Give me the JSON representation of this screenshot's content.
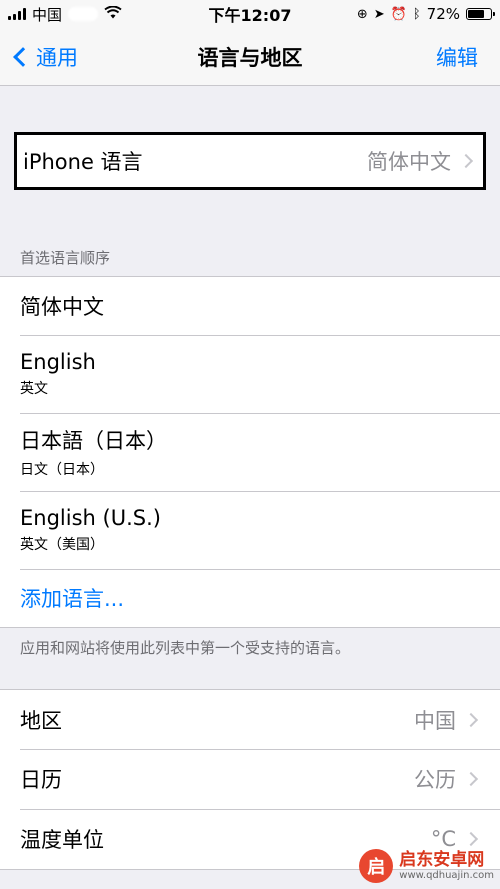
{
  "status_bar": {
    "carrier": "中国",
    "time": "下午12:07",
    "battery": "72%",
    "battery_level": 0.72,
    "icons": [
      "signal-icon",
      "wifi-icon",
      "rotation-lock-icon",
      "location-icon",
      "alarm-icon",
      "bluetooth-icon",
      "battery-icon"
    ]
  },
  "nav": {
    "back_label": "通用",
    "title": "语言与地区",
    "edit_label": "编辑"
  },
  "iphone_language": {
    "label": "iPhone 语言",
    "value": "简体中文"
  },
  "preferred": {
    "header": "首选语言顺序",
    "languages": [
      {
        "name": "简体中文",
        "sub": ""
      },
      {
        "name": "English",
        "sub": "英文"
      },
      {
        "name": "日本語（日本）",
        "sub": "日文（日本）"
      },
      {
        "name": "English (U.S.)",
        "sub": "英文（美国）"
      }
    ],
    "add_label": "添加语言...",
    "footer": "应用和网站将使用此列表中第一个受支持的语言。"
  },
  "region_group": {
    "rows": [
      {
        "label": "地区",
        "value": "中国"
      },
      {
        "label": "日历",
        "value": "公历"
      },
      {
        "label": "温度单位",
        "value": "°C"
      }
    ]
  },
  "watermark": {
    "name": "启东安卓网",
    "url": "www.qdhuajin.com"
  },
  "colors": {
    "accent": "#007aff",
    "background": "#efeff4",
    "secondary_text": "#8e8e93"
  }
}
